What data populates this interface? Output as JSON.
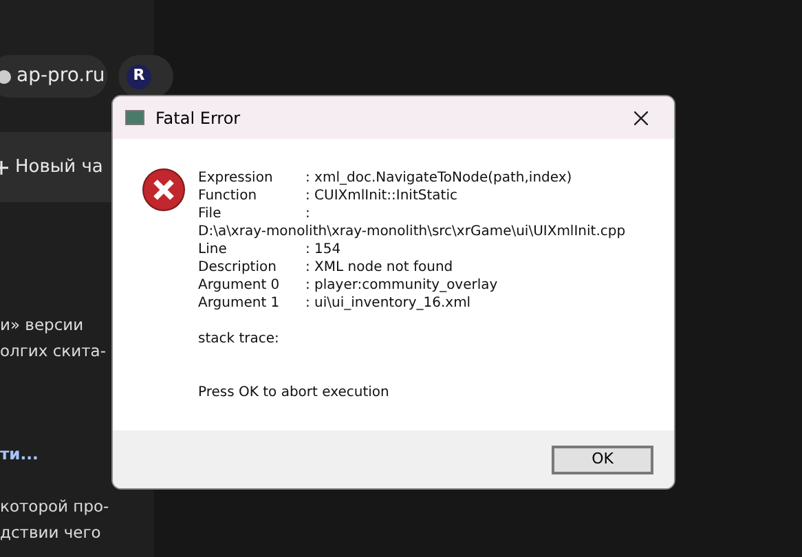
{
  "background": {
    "chips": [
      {
        "kind": "site",
        "label": "ap-pro.ru"
      },
      {
        "kind": "logo",
        "label": "R"
      }
    ],
    "new_chat": {
      "label": "Новый ча"
    },
    "text_lines": [
      {
        "kind": "text",
        "text": "и» версии"
      },
      {
        "kind": "text",
        "text": "олгих скита-"
      },
      {
        "kind": "link",
        "text": "ти..."
      },
      {
        "kind": "text",
        "text": "которой про-"
      },
      {
        "kind": "text",
        "text": "дствии чего"
      }
    ]
  },
  "dialog": {
    "title": "Fatal Error",
    "lines": [
      {
        "kind": "field",
        "label": "Expression",
        "value": ": xml_doc.NavigateToNode(path,index)"
      },
      {
        "kind": "field",
        "label": "Function",
        "value": ": CUIXmlInit::InitStatic"
      },
      {
        "kind": "field",
        "label": "File",
        "value": ":"
      },
      {
        "kind": "plain",
        "value": "D:\\a\\xray-monolith\\xray-monolith\\src\\xrGame\\ui\\UIXmlInit.cpp"
      },
      {
        "kind": "field",
        "label": "Line",
        "value": ": 154"
      },
      {
        "kind": "field",
        "label": "Description",
        "value": ": XML node not found"
      },
      {
        "kind": "field",
        "label": "Argument 0",
        "value": ": player:community_overlay"
      },
      {
        "kind": "field",
        "label": "Argument 1",
        "value": ": ui\\ui_inventory_16.xml"
      },
      {
        "kind": "gap"
      },
      {
        "kind": "plain",
        "value": "stack trace:"
      },
      {
        "kind": "gap"
      },
      {
        "kind": "gap"
      },
      {
        "kind": "plain",
        "value": "Press OK to abort execution"
      }
    ],
    "buttons": [
      "OK"
    ]
  }
}
